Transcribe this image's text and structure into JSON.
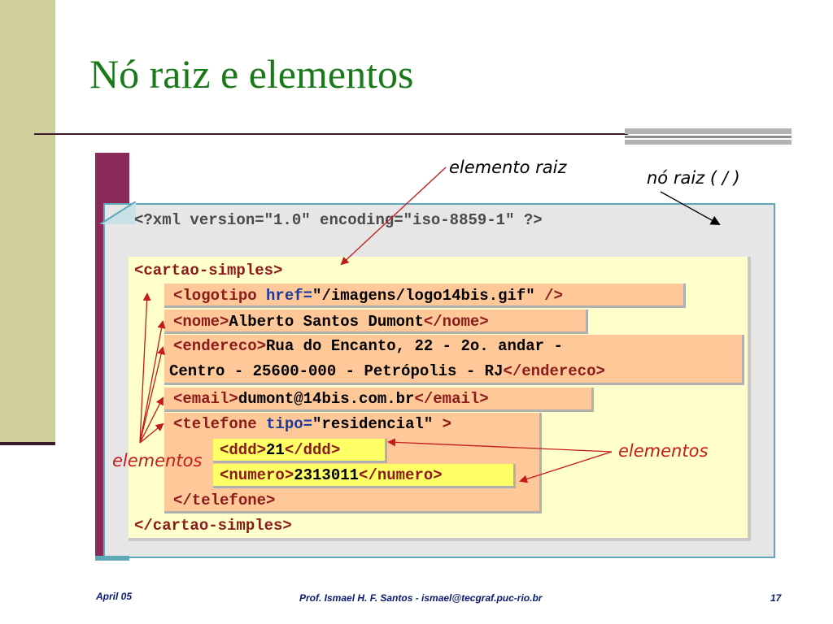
{
  "slide": {
    "title": "Nó raiz e elementos",
    "footer_left": "April 05",
    "footer_center": "Prof. Ismael H. F. Santos -  ismael@tecgraf.puc-rio.br",
    "footer_right": "17"
  },
  "colors": {
    "title": "#1a7a1a",
    "sidebar": "#cfcf9a",
    "figure_strip": "#8a2a58",
    "panel_border": "#5fa8b8",
    "tag": "#8b1a1a",
    "attr": "#1a3aa0",
    "orange_box": "#ffc899",
    "yellow_box": "#ffffcc",
    "highlight_box": "#ffff66",
    "annotation_red": "#c41a1a"
  },
  "annotations": {
    "root_element": "elemento raiz",
    "root_node": "nó raiz ( / )",
    "elements_left": "elementos",
    "elements_right": "elementos"
  },
  "xml": {
    "declaration": "<?xml version=\"1.0\" encoding=\"iso-8859-1\" ?>",
    "root_open": "<cartao-simples>",
    "root_close": "</cartao-simples>",
    "logotipo": {
      "open": "<logotipo",
      "attr": "href=",
      "value": "\"/imagens/logo14bis.gif\"",
      "close": " />"
    },
    "nome": {
      "open": "<nome>",
      "text": "Alberto Santos Dumont",
      "close": "</nome>"
    },
    "endereco": {
      "open": "<endereco>",
      "text1": "Rua do Encanto, 22 - 2o. andar -",
      "text2": "Centro - 25600-000 - Petrópolis - RJ",
      "close": "</endereco>"
    },
    "email": {
      "open": "<email>",
      "text": "dumont@14bis.com.br",
      "close": "</email>"
    },
    "telefone": {
      "open": "<telefone",
      "attr": "tipo=",
      "value": "\"residencial\"",
      "gt": " >",
      "close": "</telefone>"
    },
    "ddd": {
      "open": "<ddd>",
      "text": "21",
      "close": "</ddd>"
    },
    "numero": {
      "open": "<numero>",
      "text": "2313011",
      "close": "</numero>"
    }
  }
}
